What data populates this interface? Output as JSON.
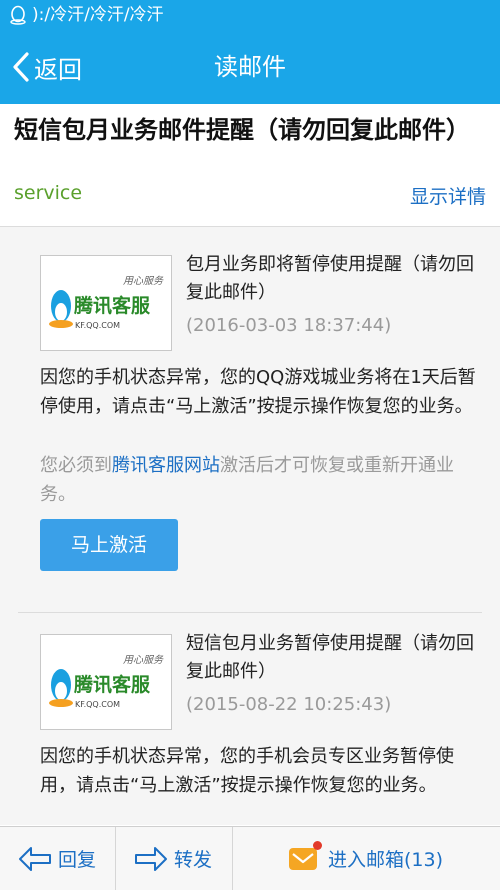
{
  "status_bar": {
    "text": "):/冷汗/冷汗/冷汗",
    "icon": "qq-penguin-icon"
  },
  "nav": {
    "back_label": "返回",
    "title": "读邮件"
  },
  "mail": {
    "subject": "短信包月业务邮件提醒（请勿回复此邮件）",
    "sender": "service",
    "show_details": "显示详情"
  },
  "notices": [
    {
      "logo_text": "腾讯客服",
      "logo_slogan": "用心服务",
      "logo_url": "KF.QQ.COM",
      "title": "包月业务即将暂停使用提醒（请勿回复此邮件）",
      "date": "(2016-03-03 18:37:44)",
      "body": "因您的手机状态异常，您的QQ游戏城业务将在1天后暂停使用，请点击“马上激活”按提示操作恢复您的业务。",
      "note_prefix": "您必须到",
      "note_link": "腾讯客服网站",
      "note_suffix": "激活后才可恢复或重新开通业务。",
      "button": "马上激活"
    },
    {
      "logo_text": "腾讯客服",
      "logo_slogan": "用心服务",
      "logo_url": "KF.QQ.COM",
      "title": "短信包月业务暂停使用提醒（请勿回复此邮件）",
      "date": "(2015-08-22 10:25:43)",
      "body": "因您的手机状态异常，您的手机会员专区业务暂停使用，请点击“马上激活”按提示操作恢复您的业务。"
    }
  ],
  "toolbar": {
    "reply": "回复",
    "forward": "转发",
    "inbox": "进入邮箱(13)"
  },
  "colors": {
    "accent": "#1aa6e8",
    "link": "#1c6fc4",
    "sender": "#5aa02c",
    "button": "#3aa0e8",
    "badge": "#e23a2a"
  }
}
